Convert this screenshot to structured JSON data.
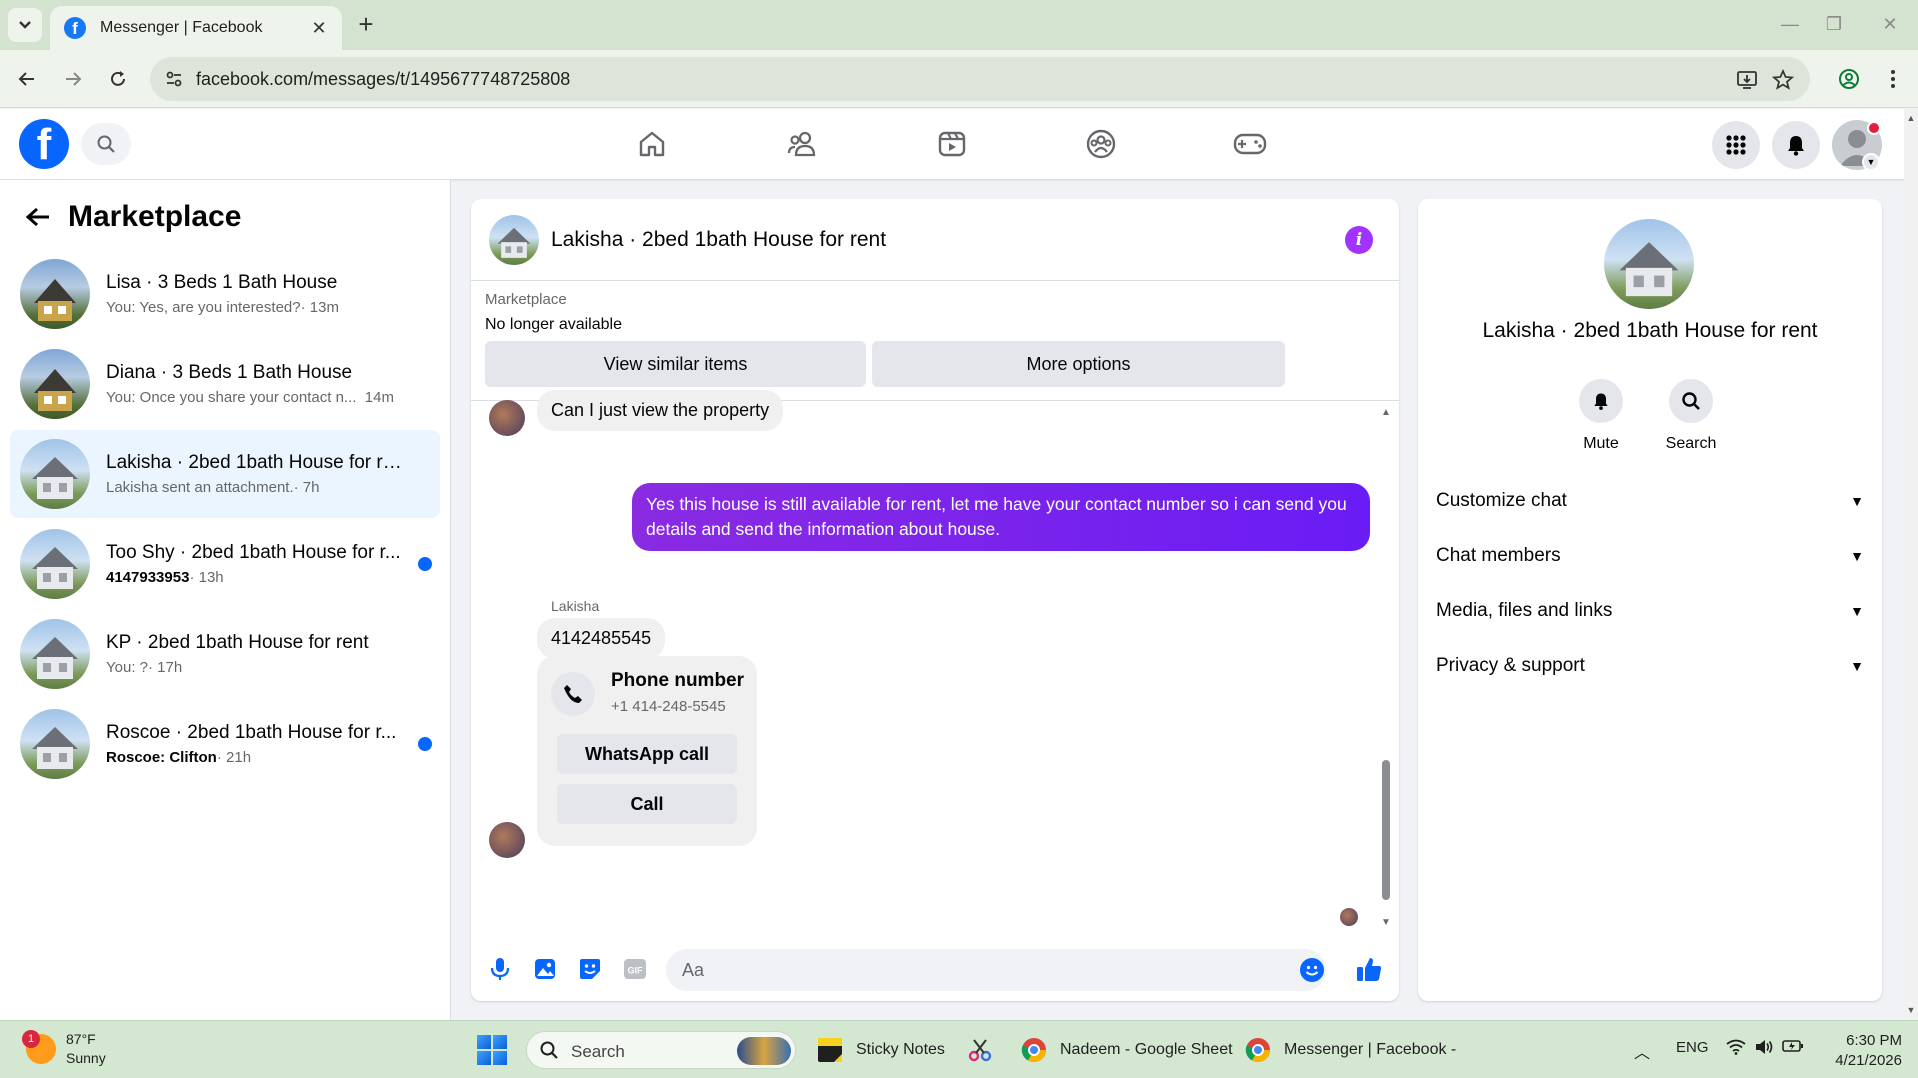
{
  "browser": {
    "tab_title": "Messenger | Facebook",
    "url": "facebook.com/messages/t/1495677748725808"
  },
  "sidebar": {
    "title": "Marketplace",
    "conversations": [
      {
        "name": "Lisa · 3 Beds 1 Bath House",
        "preview": "You: Yes, are you interested?",
        "time": "· 13m",
        "unread": false,
        "active": false
      },
      {
        "name": "Diana · 3 Beds 1 Bath House",
        "preview": "You: Once you share your contact n...",
        "time": "14m",
        "unread": false,
        "active": false
      },
      {
        "name": "Lakisha · 2bed 1bath House for rent",
        "preview": "Lakisha sent an attachment.",
        "time": "· 7h",
        "unread": false,
        "active": true
      },
      {
        "name": "Too Shy · 2bed 1bath House for r...",
        "preview": "4147933953",
        "time": "· 13h",
        "unread": true,
        "active": false
      },
      {
        "name": "KP · 2bed 1bath House for rent",
        "preview": "You: ?",
        "time": "· 17h",
        "unread": false,
        "active": false
      },
      {
        "name": "Roscoe · 2bed 1bath House for r...",
        "preview": "Roscoe: Clifton",
        "time": "· 21h",
        "unread": true,
        "active": false
      }
    ]
  },
  "chat": {
    "title": "Lakisha · 2bed 1bath House for rent",
    "marketplace_label": "Marketplace",
    "listing_status": "No longer available",
    "view_similar": "View similar items",
    "more_options": "More options",
    "msg_in_1": "Can I just view the property",
    "msg_out_1": "Yes this house is still available for rent, let me have your contact number so i can send you details and send the information about house.",
    "sender_name": "Lakisha",
    "msg_in_2": "4142485545",
    "phone_card": {
      "title": "Phone number",
      "number": "+1 414-248-5545",
      "whatsapp": "WhatsApp call",
      "call": "Call"
    },
    "composer_placeholder": "Aa"
  },
  "info_panel": {
    "name": "Lakisha · 2bed 1bath House for rent",
    "mute": "Mute",
    "search": "Search",
    "sections": [
      "Customize chat",
      "Chat members",
      "Media, files and links",
      "Privacy & support"
    ]
  },
  "taskbar": {
    "weather_badge": "1",
    "temp": "87°F",
    "condition": "Sunny",
    "search_label": "Search",
    "apps": [
      "Sticky Notes",
      "Nadeem - Google Sheet",
      "Messenger | Facebook -"
    ],
    "lang": "ENG",
    "time": "6:30 PM",
    "date": "4/21/2026"
  },
  "colors": {
    "fb_blue": "#0866ff",
    "messenger_purple": "#7b1ff2",
    "info_purple": "#a033ff",
    "unread_dot": "#0866ff",
    "active_row": "#ebf5ff"
  }
}
